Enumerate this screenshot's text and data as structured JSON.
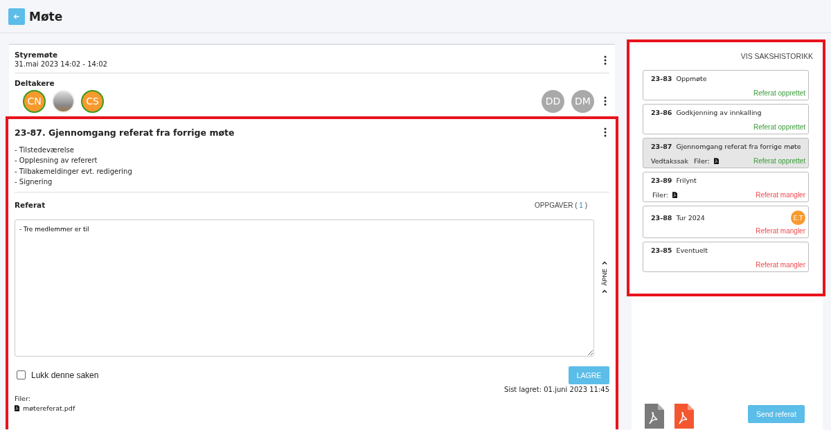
{
  "header": {
    "title": "Møte"
  },
  "meeting": {
    "title": "Styremøte",
    "time": "31.mai 2023 14:02 - 14:02",
    "participants_label": "Deltakere",
    "participants": [
      {
        "kind": "initials",
        "initials": "CN",
        "present": true
      },
      {
        "kind": "photo",
        "present": false
      },
      {
        "kind": "initials",
        "initials": "CS",
        "present": true
      }
    ],
    "guests": [
      {
        "initials": "DD"
      },
      {
        "initials": "DM"
      }
    ]
  },
  "case": {
    "title": "23-87. Gjennomgang referat fra forrige møte",
    "agenda": [
      "- Tilstedeværelse",
      "- Opplesning av referert",
      "- Tilbakemeldinger evt. redigering",
      "- Signering"
    ],
    "minutes_label": "Referat",
    "tasks_label": "OPPGAVER (",
    "tasks_count": "1",
    "tasks_close": ")",
    "minutes_value": "- Tre medlemmer er til",
    "side_tab": "ÅPNE",
    "close_case": {
      "label": "Lukk denne saken",
      "checked": false
    },
    "save_button": "LAGRE",
    "last_saved": "Sist lagret: 01.juni 2023 11:45",
    "files_label": "Filer:",
    "files": [
      "møtereferat.pdf"
    ]
  },
  "sidebar": {
    "history_link": "VIS SAKSHISTORIKK",
    "items": [
      {
        "number": "23-83",
        "title": "Oppmøte",
        "status": "Referat opprettet",
        "done": true,
        "selected": false
      },
      {
        "number": "23-86",
        "title": "Godkjenning av innkalling",
        "status": "Referat opprettet",
        "done": true,
        "selected": false
      },
      {
        "number": "23-87",
        "title": "Gjennomgang referat fra forrige møte",
        "tag": "Vedtakssak",
        "files_label": "Filer:",
        "status": "Referat opprettet",
        "done": true,
        "selected": true
      },
      {
        "number": "23-89",
        "title": "Frilynt",
        "files_label": "Filer:",
        "status": "Referat mangler",
        "done": false,
        "selected": false
      },
      {
        "number": "23-88",
        "title": "Tur 2024",
        "assignee": "E.T",
        "status": "Referat mangler",
        "done": false,
        "selected": false
      },
      {
        "number": "23-85",
        "title": "Eventuelt",
        "status": "Referat mangler",
        "done": false,
        "selected": false
      }
    ],
    "export_icons": [
      {
        "color": "#7a7a7a"
      },
      {
        "color": "#f4572f"
      }
    ],
    "send_button": "Send referat"
  }
}
